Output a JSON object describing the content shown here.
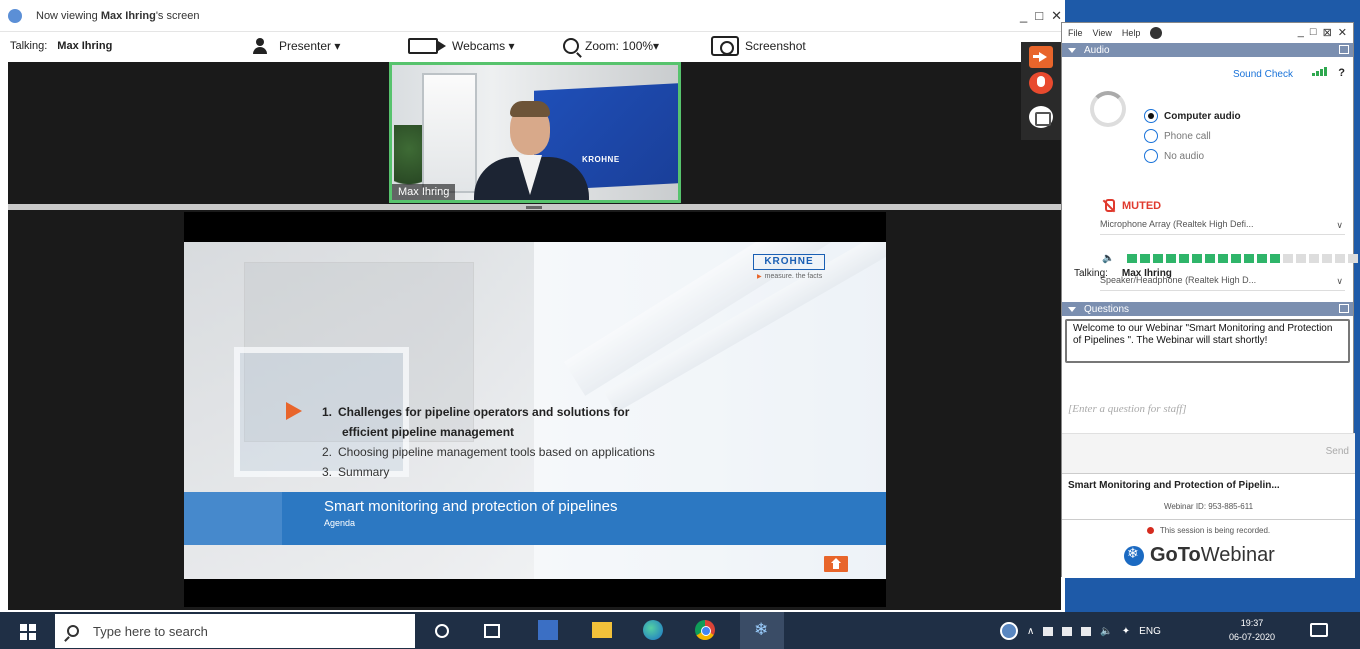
{
  "viewer": {
    "title_prefix": "Now viewing ",
    "title_name": "Max Ihring",
    "title_suffix": "'s screen",
    "talking_label": "Talking:",
    "talking_name": "Max Ihring",
    "presenter_label": "Presenter ▾",
    "webcams_label": "Webcams ▾",
    "zoom_label": "Zoom: 100%▾",
    "screenshot_label": "Screenshot",
    "controls": [
      "_",
      "□",
      "✕"
    ],
    "webcam_name": "Max Ihring",
    "webcam_banner": "KROHNE"
  },
  "slide": {
    "brand": "KROHNE",
    "tagline": "measure. the facts",
    "agenda": [
      {
        "num": "1.",
        "text": "Challenges for pipeline operators and solutions for",
        "cont": "efficient pipeline management"
      },
      {
        "num": "2.",
        "text": "Choosing pipeline management tools based on applications"
      },
      {
        "num": "3.",
        "text": "Summary"
      }
    ],
    "band_title": "Smart monitoring and protection of pipelines",
    "band_sub": "Agenda"
  },
  "panel": {
    "menu": [
      "File",
      "View",
      "Help"
    ],
    "controls": [
      "_",
      "□",
      "⊠",
      "✕"
    ],
    "audio_header": "Audio",
    "sound_check": "Sound Check",
    "qmark": "?",
    "radio_options": [
      "Computer audio",
      "Phone call",
      "No audio"
    ],
    "muted": "MUTED",
    "microphone": "Microphone Array (Realtek High Defi...",
    "speaker": "Speaker/Headphone (Realtek High D...",
    "mic_level_fraction": 0.6,
    "talking_label": "Talking:",
    "talking_name": "Max Ihring",
    "questions_header": "Questions",
    "welcome_message": "Welcome to our Webinar \"Smart Monitoring and Protection of Pipelines \". The Webinar will start shortly!",
    "question_placeholder": "[Enter a question for staff]",
    "send": "Send",
    "webinar_title": "Smart Monitoring and Protection of Pipelin...",
    "webinar_id": "Webinar ID: 953-885-611",
    "recording": "This session is being recorded.",
    "brand_bold": "GoTo",
    "brand_light": "Webinar"
  },
  "taskbar": {
    "search_placeholder": "Type here to search",
    "lang": "ENG",
    "time": "19:37",
    "date": "06-07-2020"
  }
}
